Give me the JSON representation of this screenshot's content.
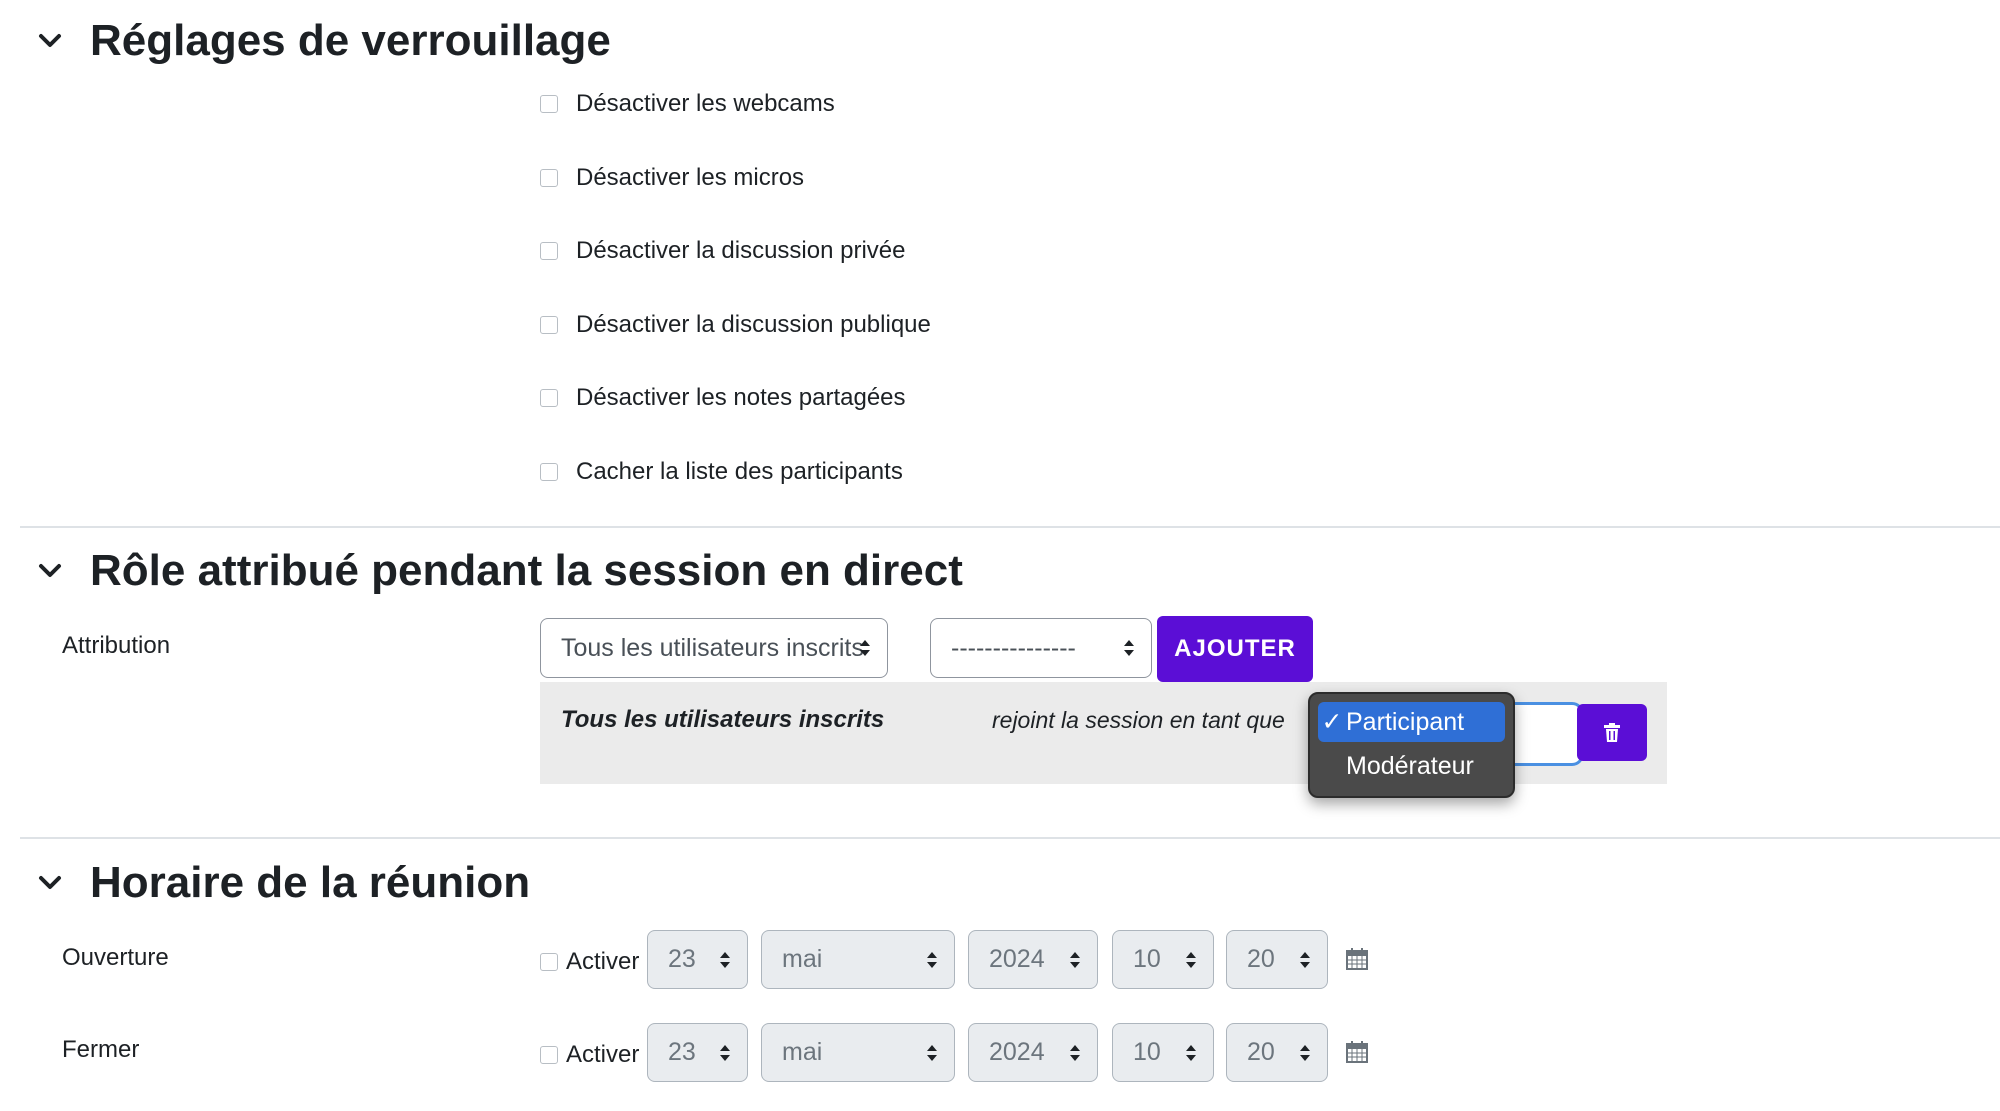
{
  "sections": {
    "lock": {
      "title": "Réglages de verrouillage",
      "options": [
        "Désactiver les webcams",
        "Désactiver les micros",
        "Désactiver la discussion privée",
        "Désactiver la discussion publique",
        "Désactiver les notes partagées",
        "Cacher la liste des participants"
      ]
    },
    "role": {
      "title": "Rôle attribué pendant la session en direct",
      "attribution_label": "Attribution",
      "select_users_value": "Tous les utilisateurs inscrits",
      "select_second_value": "---------------",
      "add_button": "AJOUTER",
      "row_user": "Tous les utilisateurs inscrits",
      "row_text": "rejoint la session en tant que",
      "dropdown_options": [
        "Participant",
        "Modérateur"
      ],
      "dropdown_selected": "Participant",
      "checkmark": "✓"
    },
    "schedule": {
      "title": "Horaire de la réunion",
      "rows": [
        {
          "label": "Ouverture",
          "enable": "Activer",
          "day": "23",
          "month": "mai",
          "year": "2024",
          "hour": "10",
          "minute": "20"
        },
        {
          "label": "Fermer",
          "enable": "Activer",
          "day": "23",
          "month": "mai",
          "year": "2024",
          "hour": "10",
          "minute": "20"
        }
      ]
    }
  },
  "colors": {
    "primary_button": "#5b0ed6",
    "dropdown_bg": "#4a4a4a",
    "dropdown_selected": "#2f6fd6",
    "row_bg": "#ebebeb"
  },
  "icons": {
    "chevron": "chevron-down-icon",
    "trash": "trash-icon",
    "calendar": "calendar-icon",
    "select_arrows": "sort-arrows-icon"
  }
}
